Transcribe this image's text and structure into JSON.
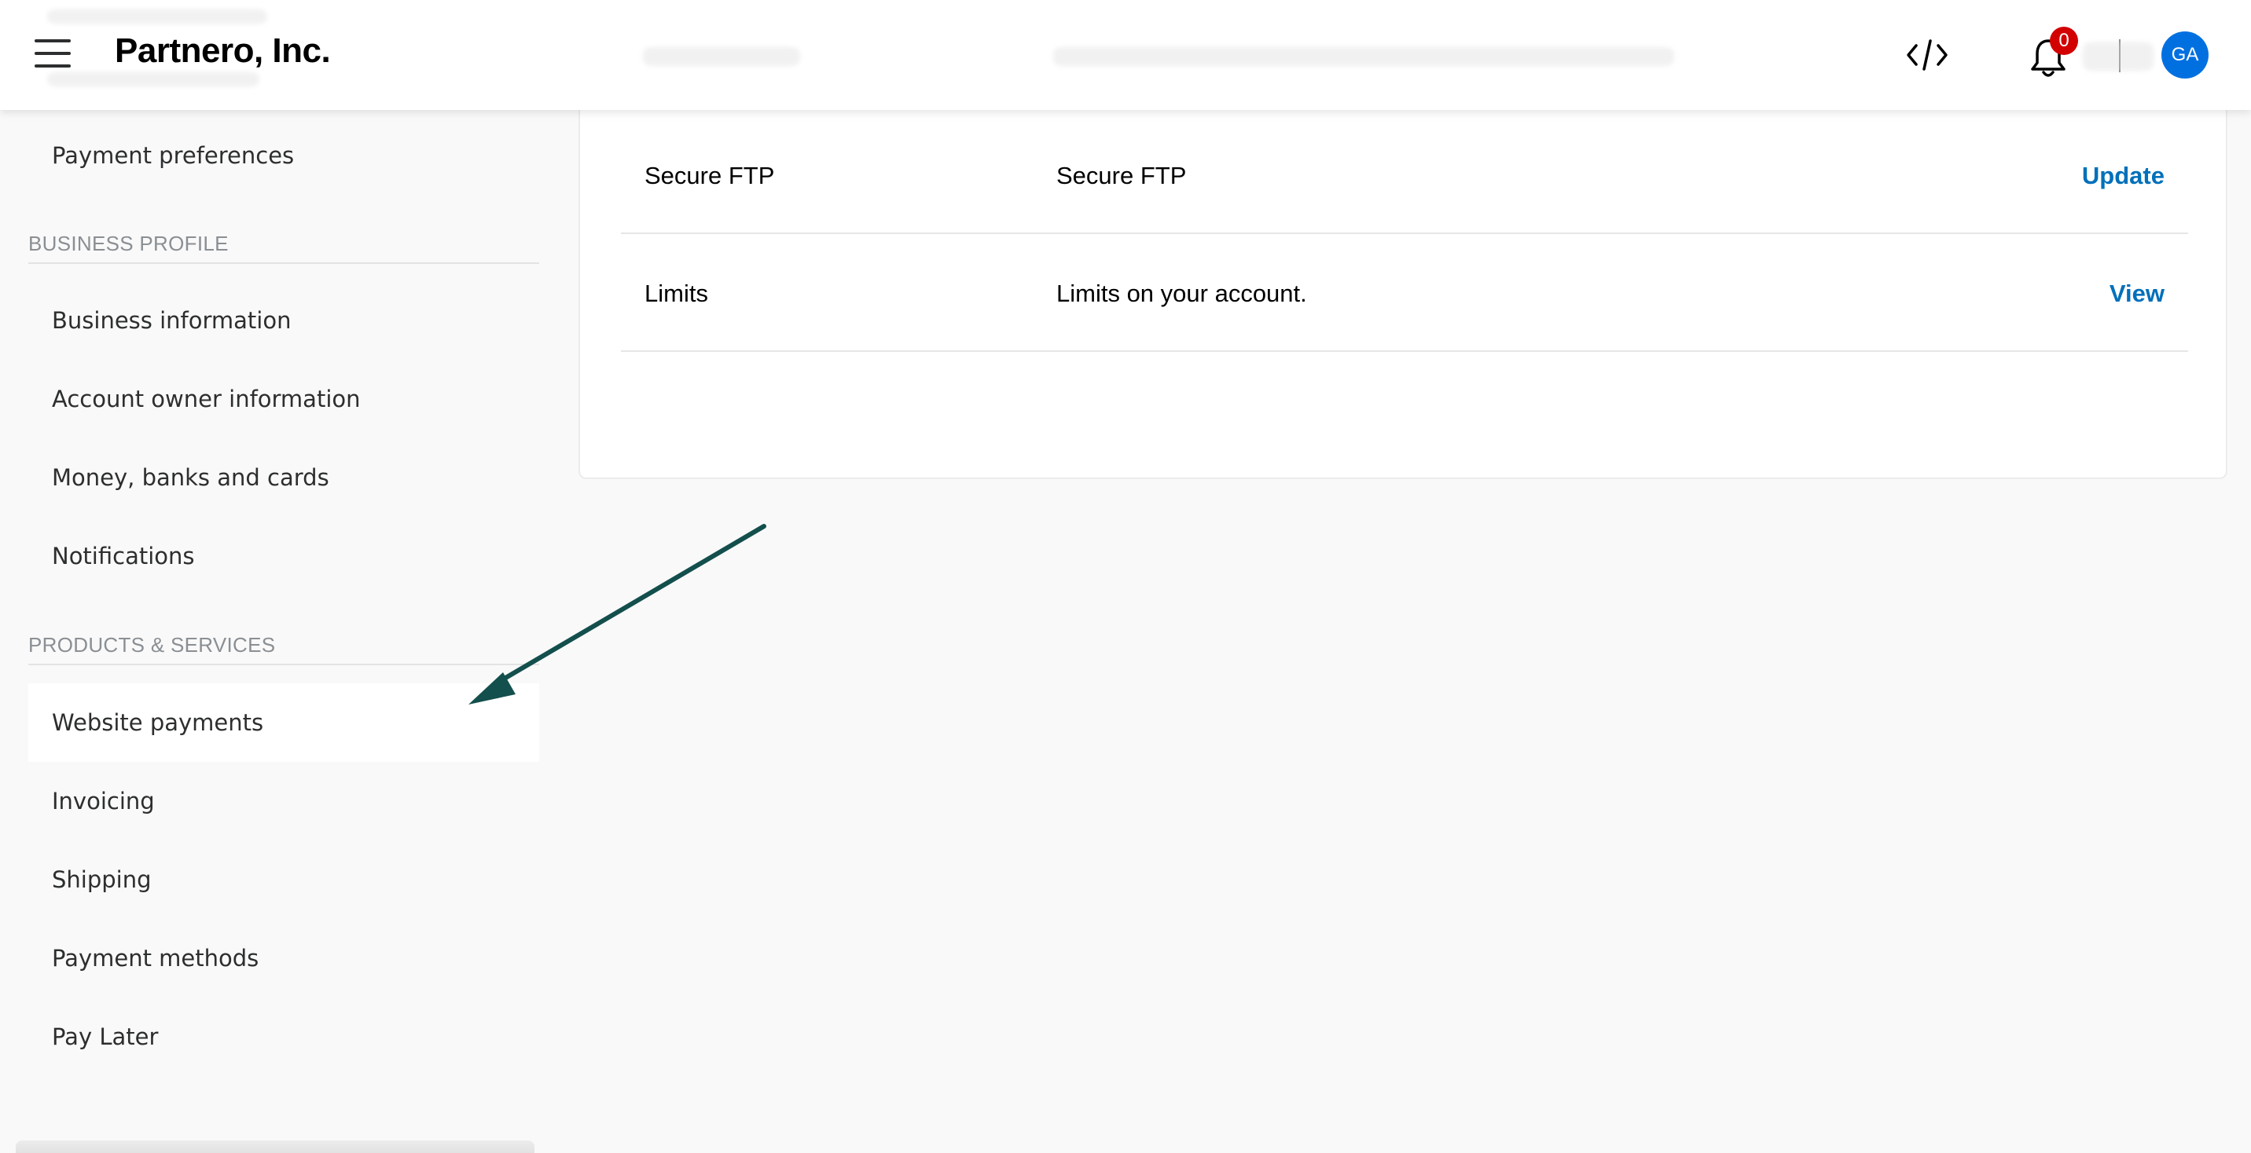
{
  "header": {
    "brand": "Partnero, Inc.",
    "notification_count": "0",
    "avatar_initials": "GA"
  },
  "sidebar": {
    "top_item": "Payment preferences",
    "sections": [
      {
        "heading": "BUSINESS PROFILE",
        "items": [
          "Business information",
          "Account owner information",
          "Money, banks and cards",
          "Notifications"
        ]
      },
      {
        "heading": "PRODUCTS & SERVICES",
        "items": [
          "Website payments",
          "Invoicing",
          "Shipping",
          "Payment methods",
          "Pay Later"
        ]
      }
    ],
    "active_item": "Website payments"
  },
  "main": {
    "rows": [
      {
        "title": "Secure FTP",
        "description": "Secure FTP",
        "action": "Update"
      },
      {
        "title": "Limits",
        "description": "Limits on your account.",
        "action": "View"
      }
    ]
  },
  "colors": {
    "accent_link": "#0070ba",
    "avatar_bg": "#0070e0",
    "badge_bg": "#d20000",
    "annotation_arrow": "#134f4c"
  }
}
